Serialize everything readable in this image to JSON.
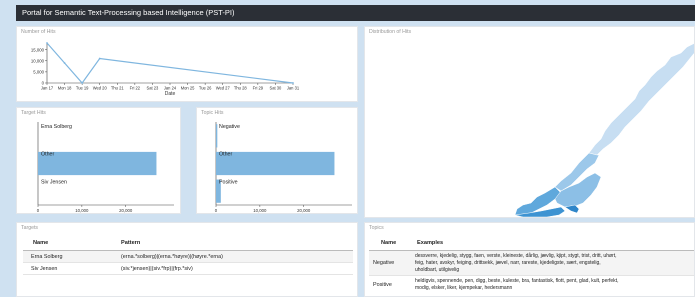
{
  "app": {
    "title": "Portal for Semantic Text-Processing based Intelligence (PST-PI)"
  },
  "hits_panel": {
    "title": "Number of Hits"
  },
  "distribution_panel": {
    "title": "Distribution of Hits"
  },
  "target_panel": {
    "title": "Target Hits"
  },
  "topic_panel": {
    "title": "Topic Hits"
  },
  "targets_table": {
    "title": "Targets",
    "columns": [
      "Name",
      "Pattern"
    ],
    "rows": [
      {
        "name": "Erna Solberg",
        "pattern": "(erna.*solberg)|(erna.*høyre)|(høyre.*erna)"
      },
      {
        "name": "Siv Jensen",
        "pattern": "(siv.*jensen)|(siv.*frp)|(frp.*siv)"
      }
    ]
  },
  "topics_table": {
    "title": "Topics",
    "columns": [
      "Name",
      "Examples"
    ],
    "rows": [
      {
        "name": "Negative",
        "examples_l1": "dessverre, kjedelig, stygg, faen, verste, kleineste, dårlig, jævlig, kjipt, stygt, trist, dritt, uhørt,",
        "examples_l2": "feig, hater, avskyr, feiging, drittsekk, jævel, narr, rareste, kjedeligste, sært, engstelig,",
        "examples_l3": "uholdbart, utilgivelig"
      },
      {
        "name": "Positive",
        "examples_l1": "heldigvis, spennende, pen, digg, beste, kuleste, bra, fantastisk, flott, pent, glad, kult, perfekt,",
        "examples_l2": "modig, elsker, liker, kjempekar, hedersmann"
      }
    ]
  },
  "colors": {
    "titlebar": "#2b2f36",
    "bar": "#7fb6df",
    "line": "#7fb6df",
    "map_light": "#c7def2",
    "map_dark": "#2f86c9"
  },
  "chart_data": [
    {
      "type": "line",
      "title": "Number of Hits",
      "xlabel": "Date",
      "ylabel": "",
      "x": [
        "Jan 17",
        "Mon 18",
        "Tue 19",
        "Wed 20",
        "Jan 31"
      ],
      "xticks": [
        "Jan 17",
        "Mon 18",
        "Tue 19",
        "Wed 20",
        "Thu 21",
        "Fri 22",
        "Sat 23",
        "Jan 24",
        "Mon 25",
        "Tue 26",
        "Wed 27",
        "Thu 28",
        "Fri 29",
        "Sat 30",
        "Jan 31"
      ],
      "y": [
        18000,
        9000,
        0,
        11000,
        0
      ],
      "yticks": [
        "0",
        "5,000",
        "10,000",
        "15,000"
      ],
      "ylim": [
        0,
        18000
      ]
    },
    {
      "type": "bar",
      "title": "Target Hits",
      "orientation": "horizontal",
      "categories": [
        "Erna Solberg",
        "Other",
        "Siv Jensen"
      ],
      "values": [
        0,
        27000,
        0
      ],
      "xticks": [
        "0",
        "10,000",
        "20,000"
      ],
      "xlim": [
        0,
        31000
      ]
    },
    {
      "type": "bar",
      "title": "Topic Hits",
      "orientation": "horizontal",
      "categories": [
        "Negative",
        "Other",
        "Positive"
      ],
      "values": [
        300,
        27000,
        1100
      ],
      "xticks": [
        "0",
        "10,000",
        "20,000"
      ],
      "xlim": [
        0,
        31000
      ]
    }
  ]
}
